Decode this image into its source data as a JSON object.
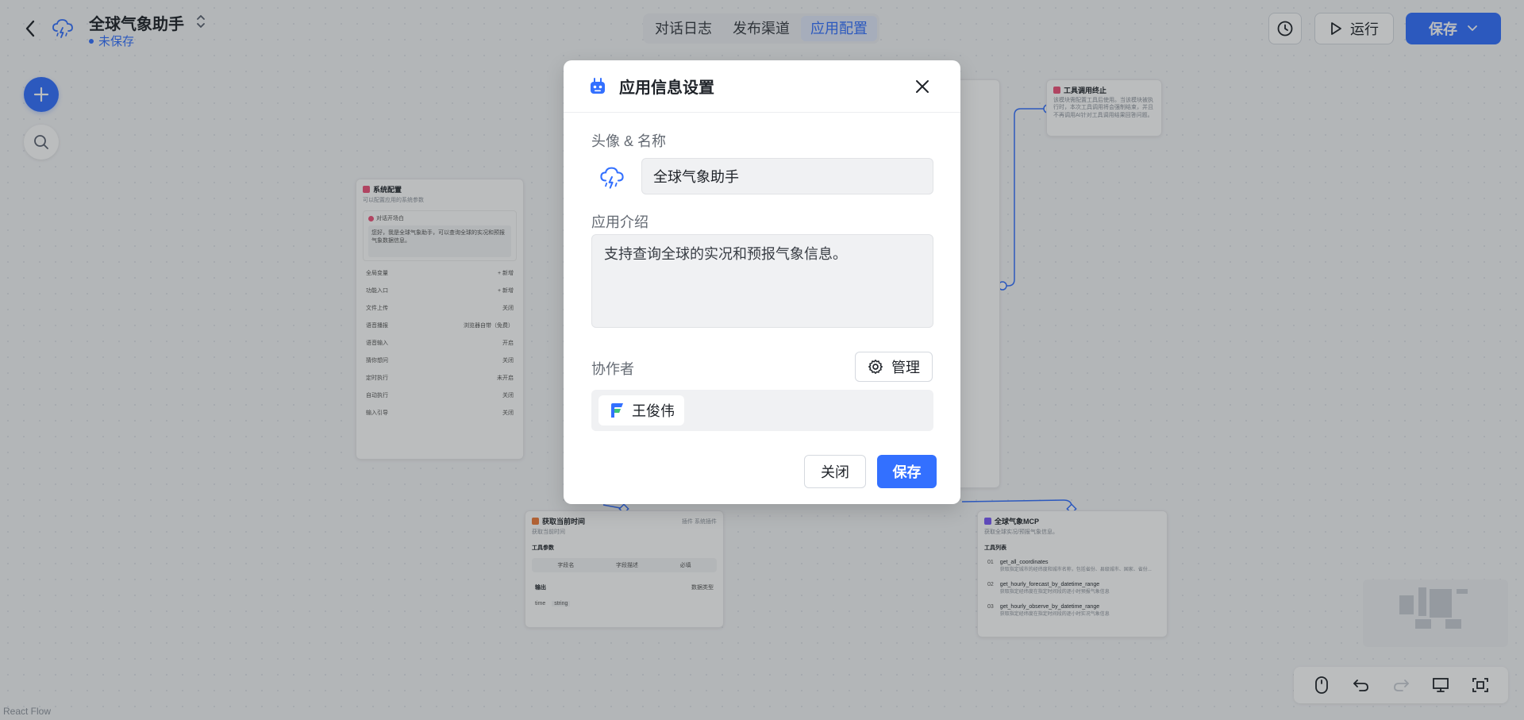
{
  "header": {
    "app_title": "全球气象助手",
    "save_status": "未保存",
    "tabs": [
      {
        "label": "对话日志"
      },
      {
        "label": "发布渠道"
      },
      {
        "label": "应用配置"
      }
    ],
    "run_label": "运行",
    "save_label": "保存"
  },
  "nodes": {
    "system_config": {
      "title": "系统配置",
      "subtitle": "可以配置应用的系统参数",
      "opening_label": "对话开场白",
      "opening_text": "您好，我是全球气象助手，可以查询全球的实况和预报气象数据信息。",
      "rows": [
        {
          "key": "全局变量",
          "value": "+ 新增"
        },
        {
          "key": "功能入口",
          "value": "+ 新增"
        },
        {
          "key": "文件上传",
          "value": "关闭"
        },
        {
          "key": "语音播报",
          "value": "浏览器自带（免费）"
        },
        {
          "key": "语音输入",
          "value": "开启"
        },
        {
          "key": "猜你想问",
          "value": "关闭"
        },
        {
          "key": "定时执行",
          "value": "未开启"
        },
        {
          "key": "自动执行",
          "value": "关闭"
        },
        {
          "key": "输入引导",
          "value": "关闭"
        }
      ]
    },
    "tool_end": {
      "title": "工具调用终止",
      "desc": "该模块需配置工具后使用。当该模块被执行时，本次工具调用将会强制结束，并且不再调用AI针对工具调用结果回答问题。"
    },
    "get_time": {
      "title": "获取当前时间",
      "badge": "插件 系统插件",
      "subtitle": "获取当前时间",
      "params_label": "工具参数",
      "param_headers": [
        "字段名",
        "字段描述",
        "必填"
      ],
      "output_label": "输出",
      "output_badge": "数据类型",
      "output_field": "time",
      "output_type": "string"
    },
    "weather_mcp": {
      "title": "全球气象MCP",
      "subtitle": "获取全球实况/预报气象信息。",
      "list_label": "工具列表",
      "tools": [
        {
          "idx": "01",
          "name": "get_all_coordinates",
          "desc": "获取指定城市的经纬度和城市名称，包括省份、县级城市、国家、省份..."
        },
        {
          "idx": "02",
          "name": "get_hourly_forecast_by_datetime_range",
          "desc": "获取指定经纬度在指定时间段的逐小时预报气象信息"
        },
        {
          "idx": "03",
          "name": "get_hourly_observe_by_datetime_range",
          "desc": "获取指定经纬度在指定时间段的逐小时实况气象信息"
        }
      ]
    }
  },
  "modal": {
    "title": "应用信息设置",
    "avatar_name_label": "头像 & 名称",
    "name_value": "全球气象助手",
    "intro_label": "应用介绍",
    "intro_value": "支持查询全球的实况和预报气象信息。",
    "collaborators_label": "协作者",
    "manage_label": "管理",
    "collaborators": [
      {
        "name": "王俊伟"
      }
    ],
    "close_label": "关闭",
    "save_label": "保存"
  },
  "footer": {
    "brand": "React Flow"
  },
  "colors": {
    "primary": "#3370ff",
    "canvas": "#f4f5f7"
  }
}
